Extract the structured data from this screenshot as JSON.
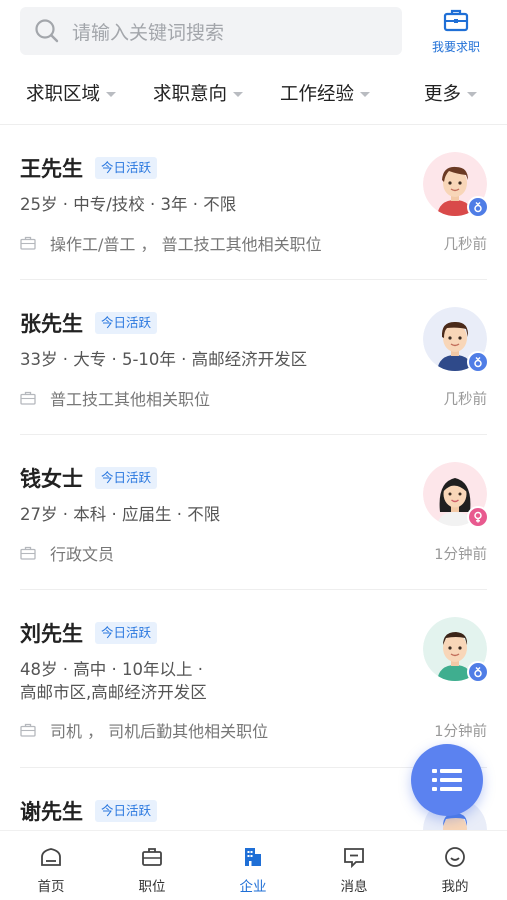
{
  "search": {
    "placeholder": "请输入关键词搜索"
  },
  "header_action": {
    "label": "我要求职",
    "icon": "briefcase-icon"
  },
  "filters": [
    {
      "label": "求职区域"
    },
    {
      "label": "求职意向"
    },
    {
      "label": "工作经验"
    },
    {
      "label": "更多"
    }
  ],
  "candidates": [
    {
      "name": "王先生",
      "badge": "今日活跃",
      "meta": "25岁 · 中专/技校 · 3年 · 不限",
      "meta2": "",
      "job": "操作工/普工 ， 普工技工其他相关职位",
      "time": "几秒前",
      "gender": "male"
    },
    {
      "name": "张先生",
      "badge": "今日活跃",
      "meta": "33岁 · 大专 · 5-10年 · 高邮经济开发区",
      "meta2": "",
      "job": "普工技工其他相关职位",
      "time": "几秒前",
      "gender": "male"
    },
    {
      "name": "钱女士",
      "badge": "今日活跃",
      "meta": "27岁 · 本科 · 应届生 · 不限",
      "meta2": "",
      "job": "行政文员",
      "time": "1分钟前",
      "gender": "female"
    },
    {
      "name": "刘先生",
      "badge": "今日活跃",
      "meta": "48岁 · 高中 · 10年以上 ·",
      "meta2": "高邮市区,高邮经济开发区",
      "job": "司机 ， 司机后勤其他相关职位",
      "time": "1分钟前",
      "gender": "male"
    },
    {
      "name": "谢先生",
      "badge": "今日活跃",
      "meta": "",
      "meta2": "",
      "job": "",
      "time": "",
      "gender": "male"
    }
  ],
  "tabs": [
    {
      "label": "首页",
      "icon": "home-icon"
    },
    {
      "label": "职位",
      "icon": "briefcase-icon"
    },
    {
      "label": "企业",
      "icon": "building-icon",
      "active": true
    },
    {
      "label": "消息",
      "icon": "message-icon"
    },
    {
      "label": "我的",
      "icon": "profile-icon"
    }
  ],
  "colors": {
    "accent": "#1f6fd6",
    "badge_bg": "#e8f1fd",
    "fab": "#5b82f0",
    "male": "#4f7de6",
    "female": "#e85a8f"
  }
}
